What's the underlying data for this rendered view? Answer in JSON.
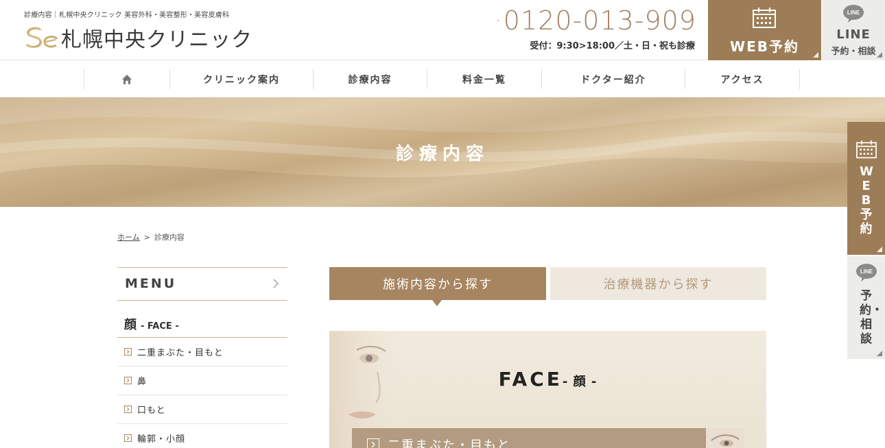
{
  "header": {
    "tagline": "診療内容｜札幌中央クリニック 美容外科・美容整形・美容皮膚科",
    "logo_text": "札幌中央クリニック",
    "phone_number": "0120-013-909",
    "phone_hours": "受付：9:30>18:00／土・日・祝も診療",
    "web_button_label": "WEB予約",
    "line_button_title": "LINE",
    "line_button_sub": "予約・相談"
  },
  "nav": {
    "items": [
      "クリニック案内",
      "診療内容",
      "料金一覧",
      "ドクター紹介",
      "アクセス"
    ]
  },
  "hero": {
    "title": "診療内容"
  },
  "breadcrumb": {
    "home": "ホーム",
    "separator": ">",
    "current": "診療内容"
  },
  "sidebar": {
    "menu_label": "MENU",
    "category": {
      "label": "顔",
      "sub": "- FACE -"
    },
    "items": [
      "二重まぶた・目もと",
      "鼻",
      "口もと",
      "輪郭・小顔"
    ]
  },
  "tabs": {
    "active": "施術内容から探す",
    "inactive": "治療機器から探す"
  },
  "content": {
    "face_title": "FACE",
    "face_sub": "- 顔 -",
    "first_item": "二重まぶた・目もと"
  },
  "floating": {
    "web_label": "WEB予約",
    "line_title": "LINE",
    "line_label": "予約・相談"
  },
  "colors": {
    "brand_brown": "#9d7d58",
    "tab_active": "#a68560",
    "tab_inactive_bg": "#eee8df",
    "line_gray": "#ececea"
  },
  "icons": [
    "freedial-icon",
    "calendar-icon",
    "line-bubble-icon",
    "home-icon",
    "chevron-right-icon",
    "arrow-box-icon"
  ]
}
